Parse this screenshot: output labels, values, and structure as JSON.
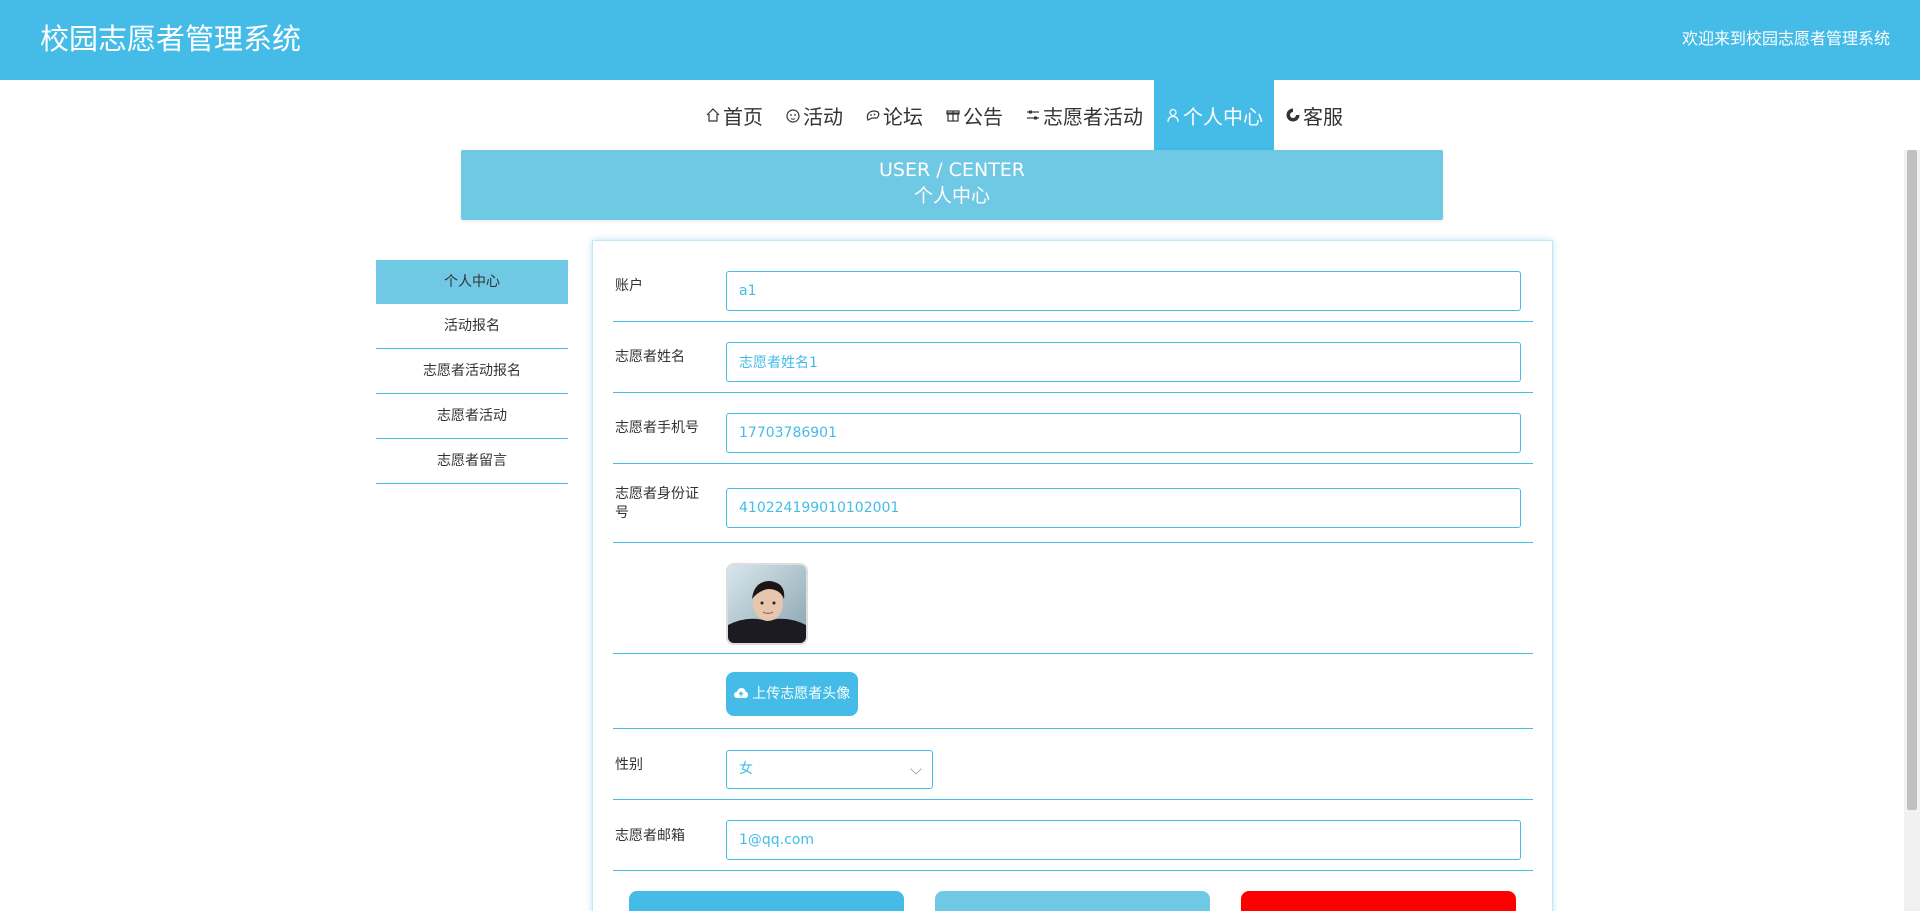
{
  "header": {
    "title": "校园志愿者管理系统",
    "welcome": "欢迎来到校园志愿者管理系统"
  },
  "nav": {
    "items": [
      {
        "label": "首页",
        "icon": "home-icon"
      },
      {
        "label": "活动",
        "icon": "activity-icon"
      },
      {
        "label": "论坛",
        "icon": "forum-icon"
      },
      {
        "label": "公告",
        "icon": "gift-icon"
      },
      {
        "label": "志愿者活动",
        "icon": "sliders-icon"
      },
      {
        "label": "个人中心",
        "icon": "user-icon",
        "active": true
      },
      {
        "label": "客服",
        "icon": "service-icon"
      }
    ]
  },
  "banner": {
    "en": "USER / CENTER",
    "cn": "个人中心"
  },
  "sidebar": {
    "items": [
      {
        "label": "个人中心",
        "active": true
      },
      {
        "label": "活动报名"
      },
      {
        "label": "志愿者活动报名"
      },
      {
        "label": "志愿者活动"
      },
      {
        "label": "志愿者留言"
      }
    ]
  },
  "form": {
    "account": {
      "label": "账户",
      "value": "a1"
    },
    "name": {
      "label": "志愿者姓名",
      "value": "志愿者姓名1"
    },
    "phone": {
      "label": "志愿者手机号",
      "value": "17703786901"
    },
    "idcard": {
      "label": "志愿者身份证号",
      "value": "410224199010102001"
    },
    "upload_label": "上传志愿者头像",
    "gender": {
      "label": "性别",
      "value": "女"
    },
    "email": {
      "label": "志愿者邮箱",
      "value": "1@qq.com"
    }
  },
  "colors": {
    "primary": "#45bce8",
    "light": "#6fc8e4",
    "danger": "#ff0000"
  }
}
